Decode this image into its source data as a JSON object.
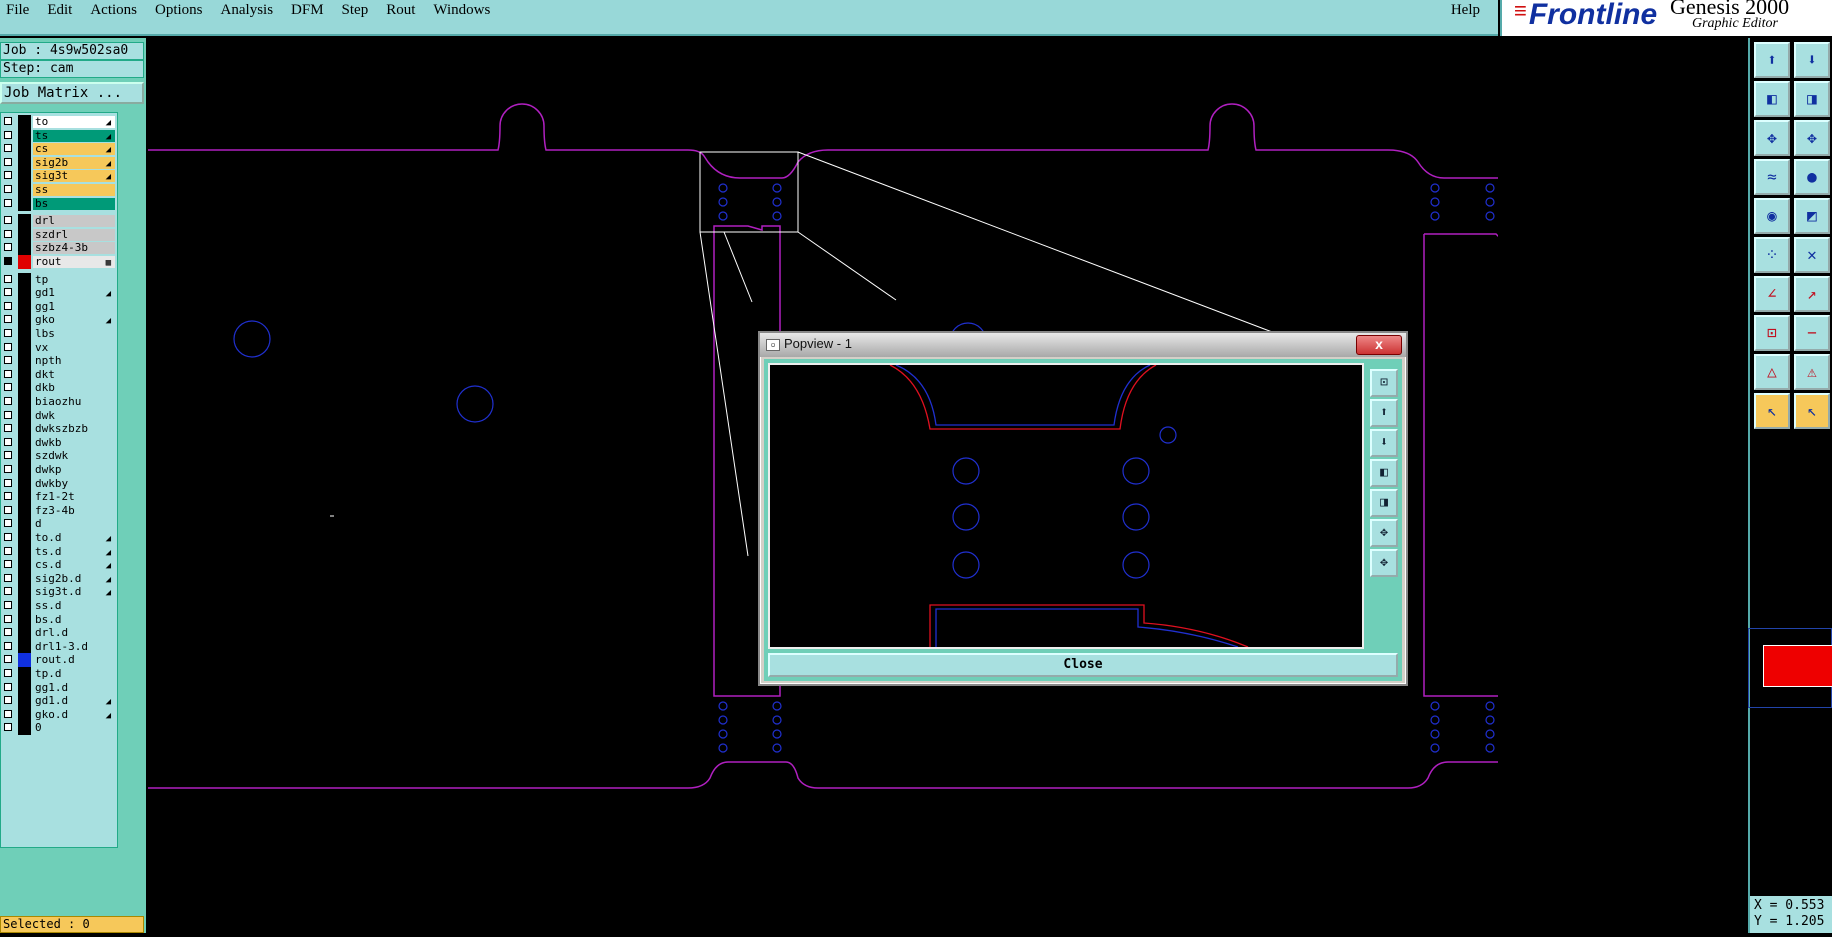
{
  "menubar": {
    "items": [
      "File",
      "Edit",
      "Actions",
      "Options",
      "Analysis",
      "DFM",
      "Step",
      "Rout",
      "Windows"
    ],
    "help": "Help"
  },
  "brand": {
    "logo": "Frontline",
    "product": "Genesis 2000",
    "subtitle": "Graphic Editor",
    "corner": "o."
  },
  "job": {
    "job_label": "Job : 4s9w502sa0",
    "step_label": "Step: cam",
    "job_matrix": "Job Matrix ..."
  },
  "layers": [
    {
      "name": "to",
      "color": "#ffffff",
      "swatch": "#000000",
      "arrow": true
    },
    {
      "name": "ts",
      "color": "#009a78",
      "swatch": "#000000",
      "arrow": true
    },
    {
      "name": "cs",
      "color": "#f6c85a",
      "swatch": "#000000",
      "arrow": true
    },
    {
      "name": "sig2b",
      "color": "#f6c85a",
      "swatch": "#000000",
      "arrow": true
    },
    {
      "name": "sig3t",
      "color": "#f6c85a",
      "swatch": "#000000",
      "arrow": true
    },
    {
      "name": "ss",
      "color": "#f6c85a",
      "swatch": "#000000",
      "arrow": false
    },
    {
      "name": "bs",
      "color": "#009a78",
      "swatch": "#000000",
      "arrow": false
    },
    {
      "name": "drl",
      "color": "#c8c8c8",
      "swatch": "#000000",
      "arrow": false
    },
    {
      "name": "szdrl",
      "color": "#c8c8c8",
      "swatch": "#000000",
      "arrow": false
    },
    {
      "name": "szbz4-3b",
      "color": "#c8c8c8",
      "swatch": "#000000",
      "arrow": false
    },
    {
      "name": "rout",
      "color": "#e8e8e8",
      "swatch": "#e00000",
      "arrow": false,
      "active": true
    },
    {
      "name": "tp",
      "color": "#a8e0e0",
      "swatch": "#000000",
      "arrow": false
    },
    {
      "name": "gd1",
      "color": "#a8e0e0",
      "swatch": "#000000",
      "arrow": true
    },
    {
      "name": "gg1",
      "color": "#a8e0e0",
      "swatch": "#000000",
      "arrow": false
    },
    {
      "name": "gko",
      "color": "#a8e0e0",
      "swatch": "#000000",
      "arrow": true
    },
    {
      "name": "lbs",
      "color": "#a8e0e0",
      "swatch": "#000000",
      "arrow": false
    },
    {
      "name": "vx",
      "color": "#a8e0e0",
      "swatch": "#000000",
      "arrow": false
    },
    {
      "name": "npth",
      "color": "#a8e0e0",
      "swatch": "#000000",
      "arrow": false
    },
    {
      "name": "dkt",
      "color": "#a8e0e0",
      "swatch": "#000000",
      "arrow": false
    },
    {
      "name": "dkb",
      "color": "#a8e0e0",
      "swatch": "#000000",
      "arrow": false
    },
    {
      "name": "biaozhu",
      "color": "#a8e0e0",
      "swatch": "#000000",
      "arrow": false
    },
    {
      "name": "dwk",
      "color": "#a8e0e0",
      "swatch": "#000000",
      "arrow": false
    },
    {
      "name": "dwkszbzb",
      "color": "#a8e0e0",
      "swatch": "#000000",
      "arrow": false
    },
    {
      "name": "dwkb",
      "color": "#a8e0e0",
      "swatch": "#000000",
      "arrow": false
    },
    {
      "name": "szdwk",
      "color": "#a8e0e0",
      "swatch": "#000000",
      "arrow": false
    },
    {
      "name": "dwkp",
      "color": "#a8e0e0",
      "swatch": "#000000",
      "arrow": false
    },
    {
      "name": "dwkby",
      "color": "#a8e0e0",
      "swatch": "#000000",
      "arrow": false
    },
    {
      "name": "fz1-2t",
      "color": "#a8e0e0",
      "swatch": "#000000",
      "arrow": false
    },
    {
      "name": "fz3-4b",
      "color": "#a8e0e0",
      "swatch": "#000000",
      "arrow": false
    },
    {
      "name": "d",
      "color": "#a8e0e0",
      "swatch": "#000000",
      "arrow": false
    },
    {
      "name": "to.d",
      "color": "#a8e0e0",
      "swatch": "#000000",
      "arrow": true
    },
    {
      "name": "ts.d",
      "color": "#a8e0e0",
      "swatch": "#000000",
      "arrow": true
    },
    {
      "name": "cs.d",
      "color": "#a8e0e0",
      "swatch": "#000000",
      "arrow": true
    },
    {
      "name": "sig2b.d",
      "color": "#a8e0e0",
      "swatch": "#000000",
      "arrow": true
    },
    {
      "name": "sig3t.d",
      "color": "#a8e0e0",
      "swatch": "#000000",
      "arrow": true
    },
    {
      "name": "ss.d",
      "color": "#a8e0e0",
      "swatch": "#000000",
      "arrow": false
    },
    {
      "name": "bs.d",
      "color": "#a8e0e0",
      "swatch": "#000000",
      "arrow": false
    },
    {
      "name": "drl.d",
      "color": "#a8e0e0",
      "swatch": "#000000",
      "arrow": false
    },
    {
      "name": "drl1-3.d",
      "color": "#a8e0e0",
      "swatch": "#000000",
      "arrow": false
    },
    {
      "name": "rout.d",
      "color": "#a8e0e0",
      "swatch": "#1030e0",
      "arrow": false
    },
    {
      "name": "tp.d",
      "color": "#a8e0e0",
      "swatch": "#000000",
      "arrow": false
    },
    {
      "name": "gg1.d",
      "color": "#a8e0e0",
      "swatch": "#000000",
      "arrow": false
    },
    {
      "name": "gd1.d",
      "color": "#a8e0e0",
      "swatch": "#000000",
      "arrow": true
    },
    {
      "name": "gko.d",
      "color": "#a8e0e0",
      "swatch": "#000000",
      "arrow": true
    },
    {
      "name": "0",
      "color": "#a8e0e0",
      "swatch": "#000000",
      "arrow": false
    }
  ],
  "status": {
    "selected": "Selected : 0"
  },
  "coords": {
    "x": "X = 0.553",
    "y": "Y = 1.205"
  },
  "popview": {
    "title": "Popview - 1",
    "close_label": "Close",
    "close_x": "x"
  },
  "colors": {
    "outline": "#b020c0",
    "drill": "#2030d0",
    "zoom_box": "#ffffff"
  }
}
